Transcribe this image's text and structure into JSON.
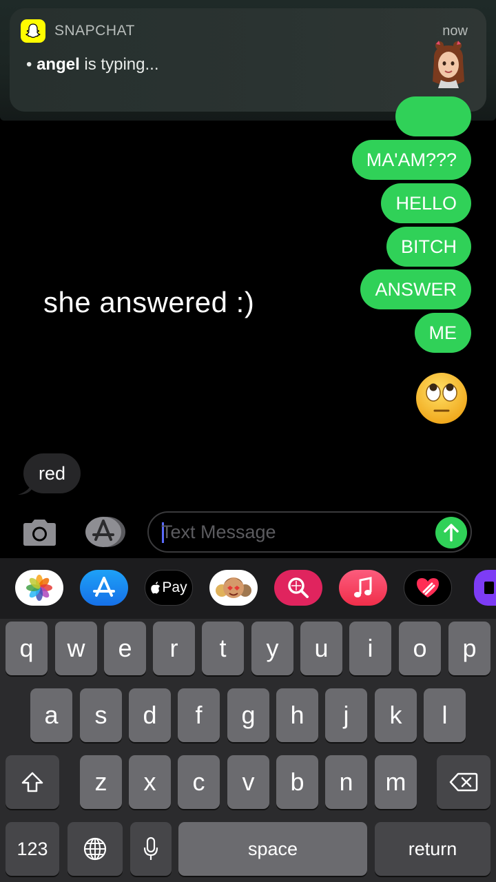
{
  "notification": {
    "app_name": "SNAPCHAT",
    "time": "now",
    "sender": "angel",
    "message_suffix": " is typing...",
    "bullet": "•"
  },
  "chat": {
    "sent_messages": [
      "MA'AM???",
      "HELLO",
      "BITCH",
      "ANSWER",
      "ME"
    ],
    "sent_emoji": "eye-roll-emoji",
    "caption": "she answered :)",
    "received_message": "red"
  },
  "input_bar": {
    "placeholder": "Text Message"
  },
  "app_strip": [
    {
      "name": "photos-app-icon"
    },
    {
      "name": "app-store-icon"
    },
    {
      "name": "apple-pay-icon",
      "label": "Pay"
    },
    {
      "name": "memoji-stickers-icon"
    },
    {
      "name": "search-images-icon"
    },
    {
      "name": "music-icon"
    },
    {
      "name": "digital-touch-icon"
    },
    {
      "name": "more-app-icon"
    }
  ],
  "keyboard": {
    "row1": [
      "q",
      "w",
      "e",
      "r",
      "t",
      "y",
      "u",
      "i",
      "o",
      "p"
    ],
    "row2": [
      "a",
      "s",
      "d",
      "f",
      "g",
      "h",
      "j",
      "k",
      "l"
    ],
    "row3": [
      "z",
      "x",
      "c",
      "v",
      "b",
      "n",
      "m"
    ],
    "numbers_label": "123",
    "space_label": "space",
    "return_label": "return"
  },
  "colors": {
    "sent_bubble": "#30d158",
    "received_bubble": "#262628",
    "snapchat_yellow": "#fffc00"
  }
}
